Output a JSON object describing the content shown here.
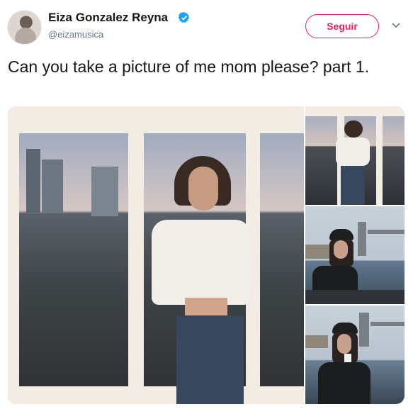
{
  "user": {
    "display_name": "Eiza Gonzalez Reyna",
    "handle": "@eizamusica",
    "verified": true
  },
  "actions": {
    "follow_label": "Seguir",
    "menu_icon": "chevron-down-icon"
  },
  "tweet": {
    "text": "Can you take a picture of me mom please? part 1."
  },
  "media": {
    "photo_count": 4
  },
  "colors": {
    "follow_accent": "#e0245e",
    "verified_blue": "#1da1f2",
    "handle_gray": "#657786",
    "text": "#14171a"
  }
}
